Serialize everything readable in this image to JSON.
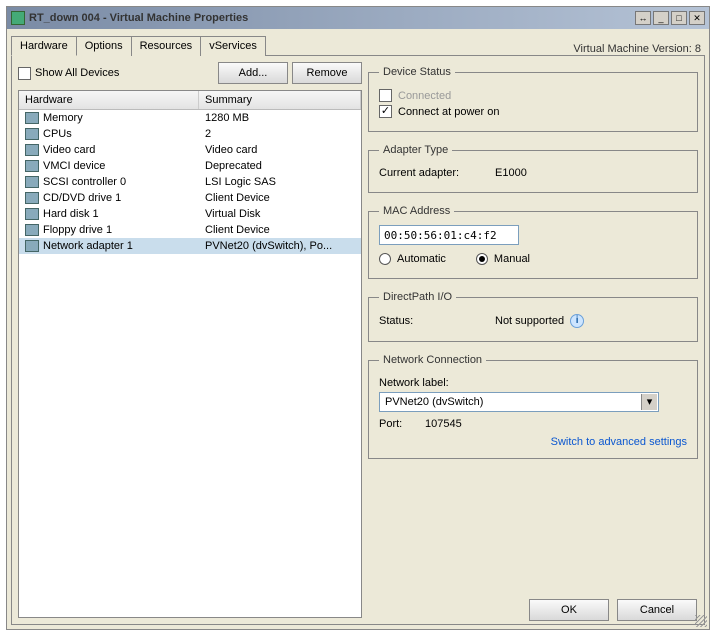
{
  "window": {
    "title": "RT_down 004 - Virtual Machine Properties",
    "version_label": "Virtual Machine Version: 8"
  },
  "tabs": {
    "items": [
      "Hardware",
      "Options",
      "Resources",
      "vServices"
    ],
    "active": 0
  },
  "left_controls": {
    "show_all_label": "Show All Devices",
    "add_label": "Add...",
    "remove_label": "Remove"
  },
  "list": {
    "headers": [
      "Hardware",
      "Summary"
    ],
    "rows": [
      {
        "name": "Memory",
        "summary": "1280 MB"
      },
      {
        "name": "CPUs",
        "summary": "2"
      },
      {
        "name": "Video card",
        "summary": "Video card"
      },
      {
        "name": "VMCI device",
        "summary": "Deprecated"
      },
      {
        "name": "SCSI controller 0",
        "summary": "LSI Logic SAS"
      },
      {
        "name": "CD/DVD drive 1",
        "summary": "Client Device"
      },
      {
        "name": "Hard disk 1",
        "summary": "Virtual Disk"
      },
      {
        "name": "Floppy drive 1",
        "summary": "Client Device"
      },
      {
        "name": "Network adapter 1",
        "summary": "PVNet20 (dvSwitch), Po..."
      }
    ],
    "selected_index": 8
  },
  "right": {
    "device_status": {
      "legend": "Device Status",
      "connected_label": "Connected",
      "connected_checked": false,
      "connected_enabled": false,
      "poweron_label": "Connect at power on",
      "poweron_checked": true
    },
    "adapter_type": {
      "legend": "Adapter Type",
      "label": "Current adapter:",
      "value": "E1000"
    },
    "mac": {
      "legend": "MAC Address",
      "value": "00:50:56:01:c4:f2",
      "auto_label": "Automatic",
      "manual_label": "Manual",
      "is_manual": true
    },
    "directpath": {
      "legend": "DirectPath I/O",
      "status_label": "Status:",
      "status_value": "Not supported"
    },
    "network": {
      "legend": "Network Connection",
      "label": "Network label:",
      "selected": "PVNet20 (dvSwitch)",
      "port_label": "Port:",
      "port_value": "107545",
      "advanced_link": "Switch to advanced settings"
    }
  },
  "buttons": {
    "ok": "OK",
    "cancel": "Cancel"
  }
}
